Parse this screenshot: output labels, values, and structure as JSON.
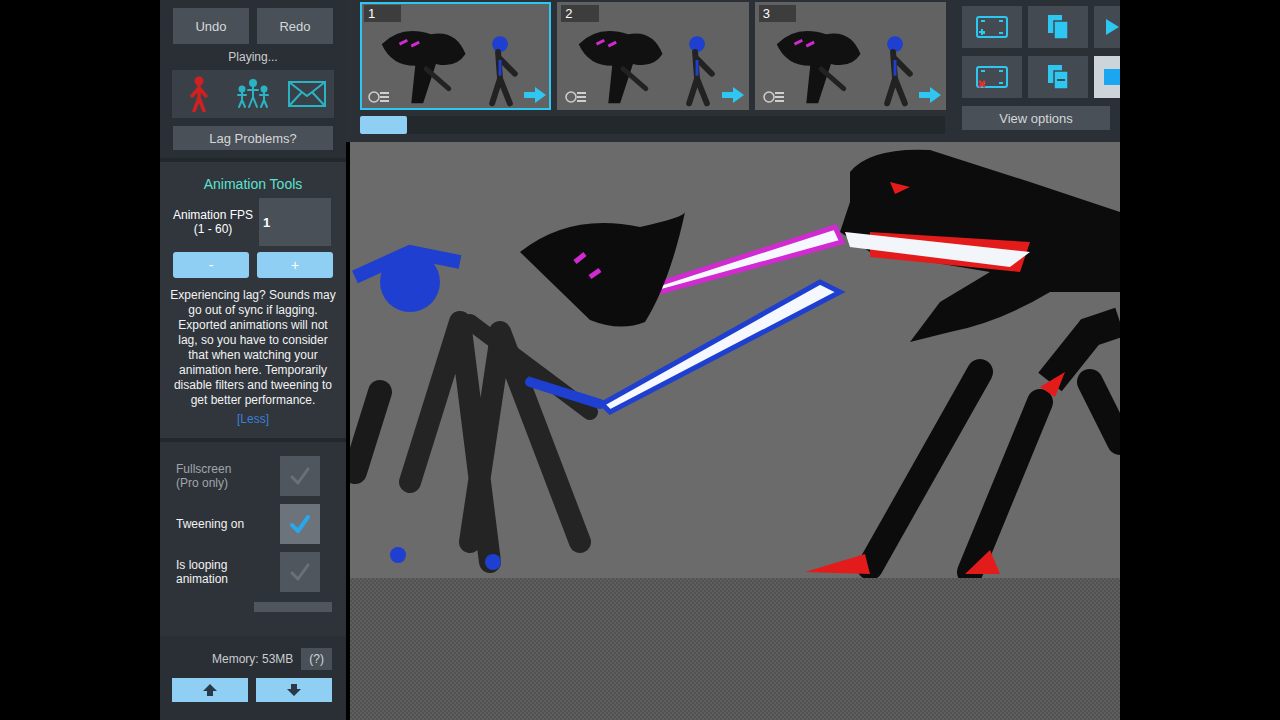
{
  "sidebar": {
    "undo": "Undo",
    "redo": "Redo",
    "status": "Playing...",
    "lag_button": "Lag Problems?"
  },
  "animation_tools": {
    "title": "Animation Tools",
    "fps_label": "Animation FPS",
    "fps_range": "(1 - 60)",
    "fps_value": "1",
    "minus": "-",
    "plus": "+",
    "help": "Experiencing lag? Sounds may go out of sync if lagging. Exported animations will not lag, so you have to consider that when watching your animation here. Temporarily disable filters and tweening to get better performance.",
    "less_link": "[Less]"
  },
  "options": [
    {
      "label": "Fullscreen",
      "note": "(Pro only)",
      "checked": false,
      "disabled": true
    },
    {
      "label": "Tweening on",
      "note": "",
      "checked": true,
      "disabled": false
    },
    {
      "label": "Is looping animation",
      "note": "",
      "checked": false,
      "disabled": false
    }
  ],
  "footer": {
    "memory": "Memory: 53MB",
    "help_button": "(?)"
  },
  "frames": [
    {
      "number": "1",
      "selected": true
    },
    {
      "number": "2",
      "selected": false
    },
    {
      "number": "3",
      "selected": false
    }
  ],
  "timeline": {
    "level": 0.08
  },
  "controls": [
    {
      "kind": "add",
      "selected": false
    },
    {
      "kind": "copy",
      "selected": false
    },
    {
      "kind": "play",
      "selected": false
    },
    {
      "kind": "delete",
      "selected": false
    },
    {
      "kind": "paste",
      "selected": false
    },
    {
      "kind": "stop",
      "selected": true
    }
  ],
  "view_options": "View options"
}
